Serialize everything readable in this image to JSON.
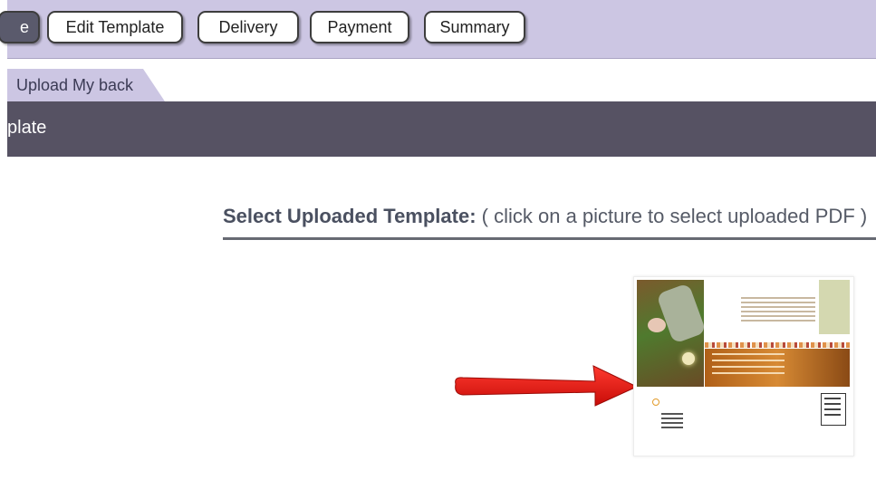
{
  "nav": {
    "partial_label": "e",
    "buttons": [
      "Edit Template",
      "Delivery",
      "Payment",
      "Summary"
    ]
  },
  "subnav": {
    "tab_label": "Upload My back"
  },
  "header": {
    "title": "plate"
  },
  "main": {
    "select_label_bold": "Select Uploaded Template:",
    "select_label_hint": " ( click on a picture to select uploaded PDF )"
  },
  "colors": {
    "nav_bg": "#ccc6e3",
    "header_bg": "#565263",
    "arrow": "#e3160f"
  }
}
